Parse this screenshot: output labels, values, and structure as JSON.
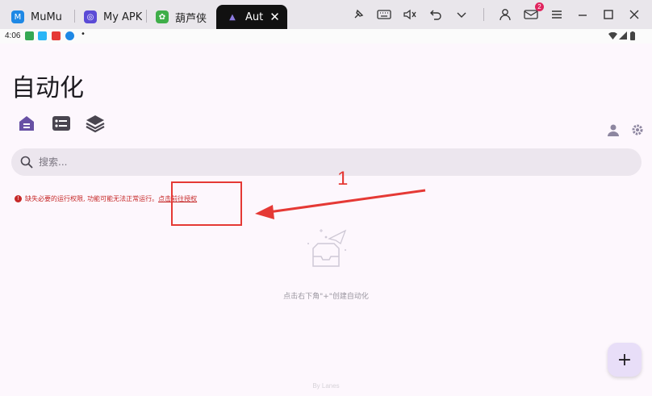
{
  "tabs": [
    {
      "label": "MuMu",
      "icon": "mumu-icon",
      "color": "#1e88e5"
    },
    {
      "label": "My APK",
      "icon": "my-apk-icon",
      "color": "#5b4bd6"
    },
    {
      "label": "葫芦侠",
      "icon": "huluxia-icon",
      "color": "#3fae49"
    },
    {
      "label": "Aut",
      "icon": "autojs-icon",
      "color": "#6a5acd"
    }
  ],
  "toolbar": {
    "mail_badge": "2"
  },
  "statusbar": {
    "time": "4:06"
  },
  "app": {
    "title": "自动化",
    "search_placeholder": "搜索...",
    "warning_text": "缺失必要的运行权限, 功能可能无法正常运行。",
    "warning_link": "点击前往授权",
    "empty_text": "点击右下角\"+\"创建自动化",
    "footer": "By Lanes",
    "fab_label": "+"
  },
  "annotation": {
    "number": "1",
    "color": "#e53935"
  },
  "colors": {
    "accent": "#6750a4",
    "fab_bg": "#e8def8",
    "warning": "#c62828"
  }
}
